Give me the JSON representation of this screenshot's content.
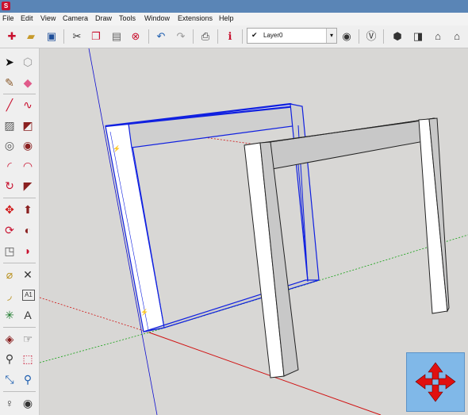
{
  "menu": {
    "items": [
      "File",
      "Edit",
      "View",
      "Camera",
      "Draw",
      "Tools",
      "Window",
      "Extensions",
      "Help"
    ]
  },
  "toolbar": {
    "layer_selected": "Layer0",
    "layer_check": "✔"
  },
  "left_toolbar": {
    "text_tool_label": "A1"
  },
  "model": {
    "group_selected": true
  },
  "colors": {
    "selection": "#1020e0",
    "axis_red": "#d01010",
    "axis_green": "#10a010",
    "axis_blue": "#1010d0",
    "nav_widget": "#80b8e8"
  }
}
